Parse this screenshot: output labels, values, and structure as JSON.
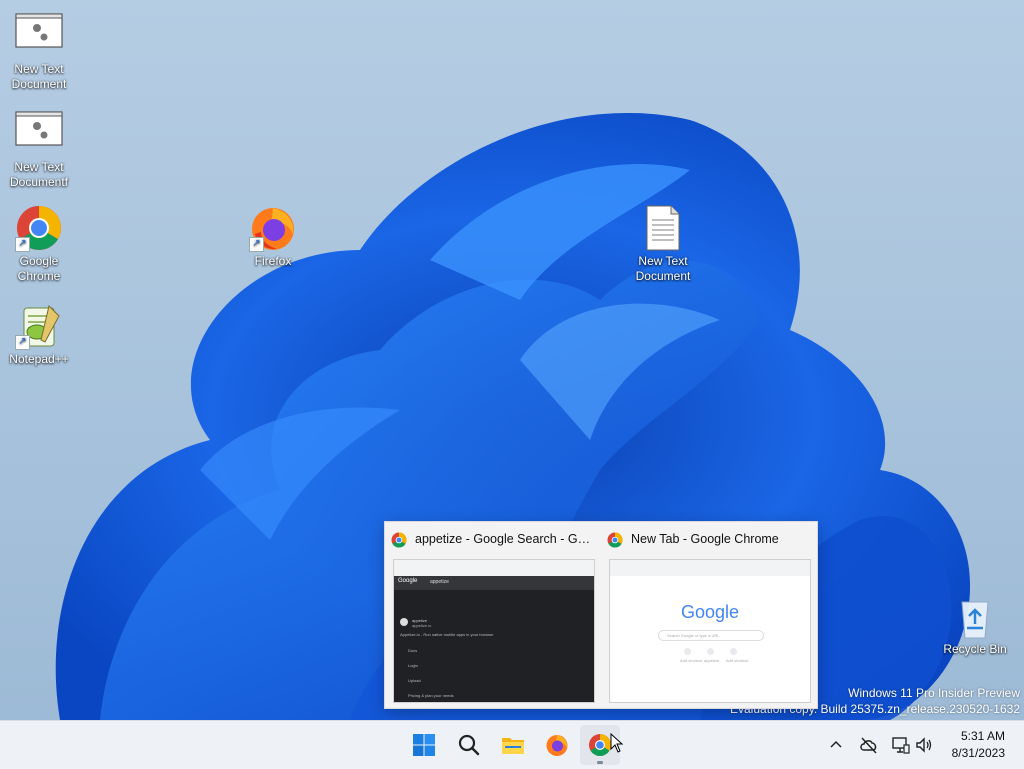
{
  "desktop": {
    "icons": [
      {
        "label": "New Text Document",
        "icon": "generic-file-gear-icon"
      },
      {
        "label": "New Text Documentf",
        "icon": "generic-file-gear-icon"
      },
      {
        "label": "Google Chrome",
        "icon": "chrome-icon"
      },
      {
        "label": "Notepad++",
        "icon": "notepadpp-icon"
      },
      {
        "label": "Firefox",
        "icon": "firefox-icon"
      },
      {
        "label": "New Text Document",
        "icon": "text-document-icon"
      },
      {
        "label": "Recycle Bin",
        "icon": "recycle-bin-icon"
      }
    ],
    "watermark": {
      "line1": "Windows 11 Pro Insider Preview",
      "line2": "Evaluation copy. Build 25375.zn_release.230520-1632"
    }
  },
  "thumbnails": [
    {
      "title": "appetize - Google Search - Goo...",
      "preview": {
        "logo": "Google",
        "query": "appetize",
        "result_title": "appetize",
        "result_lines": [
          "appetize.io",
          "Appetize.io - Run native mobile apps in your browser",
          "Docs",
          "Login",
          "Upload",
          "Pricing & plan your needs"
        ]
      }
    },
    {
      "title": "New Tab - Google Chrome",
      "preview": {
        "logo": "Google",
        "search_placeholder": "Search Google or type a URL",
        "shortcuts": [
          "Add shortcut",
          "appetize",
          "Add shortcut"
        ]
      }
    }
  ],
  "taskbar": {
    "apps": [
      {
        "name": "start",
        "icon": "windows-start-icon"
      },
      {
        "name": "search",
        "icon": "search-icon"
      },
      {
        "name": "file-explorer",
        "icon": "folder-icon"
      },
      {
        "name": "firefox",
        "icon": "firefox-icon"
      },
      {
        "name": "chrome",
        "icon": "chrome-icon",
        "active": true
      }
    ],
    "tray": {
      "icons": [
        "chevron-up-icon",
        "cloud-offline-icon",
        "network-icon",
        "volume-icon"
      ],
      "time": "5:31 AM",
      "date": "8/31/2023"
    }
  },
  "colors": {
    "taskbar_bg": "#eef1f6",
    "wallpaper_sky": "#aec8e0",
    "bloom_blue": "#1565e0",
    "chrome_red": "#db4437",
    "chrome_yellow": "#f4b400",
    "chrome_green": "#0f9d58",
    "chrome_blue": "#4285f4"
  }
}
